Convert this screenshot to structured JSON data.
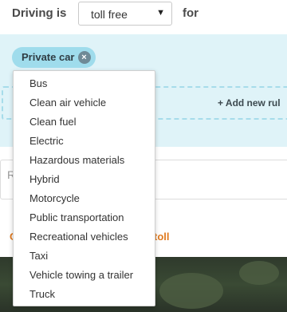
{
  "header": {
    "prefix_label": "Driving is",
    "select_value": "toll free",
    "caret": "▼",
    "suffix_label": "for"
  },
  "rule": {
    "chip_label": "Private car",
    "chip_close": "×",
    "add_rule_label": "+ Add new rul"
  },
  "lower": {
    "partial_letter": "R",
    "partial_c": "C",
    "toll_text": "toll"
  },
  "dropdown": {
    "items": [
      "Bus",
      "Clean air vehicle",
      "Clean fuel",
      "Electric",
      "Hazardous materials",
      "Hybrid",
      "Motorcycle",
      "Public transportation",
      "Recreational vehicles",
      "Taxi",
      "Vehicle towing a trailer",
      "Truck"
    ]
  }
}
